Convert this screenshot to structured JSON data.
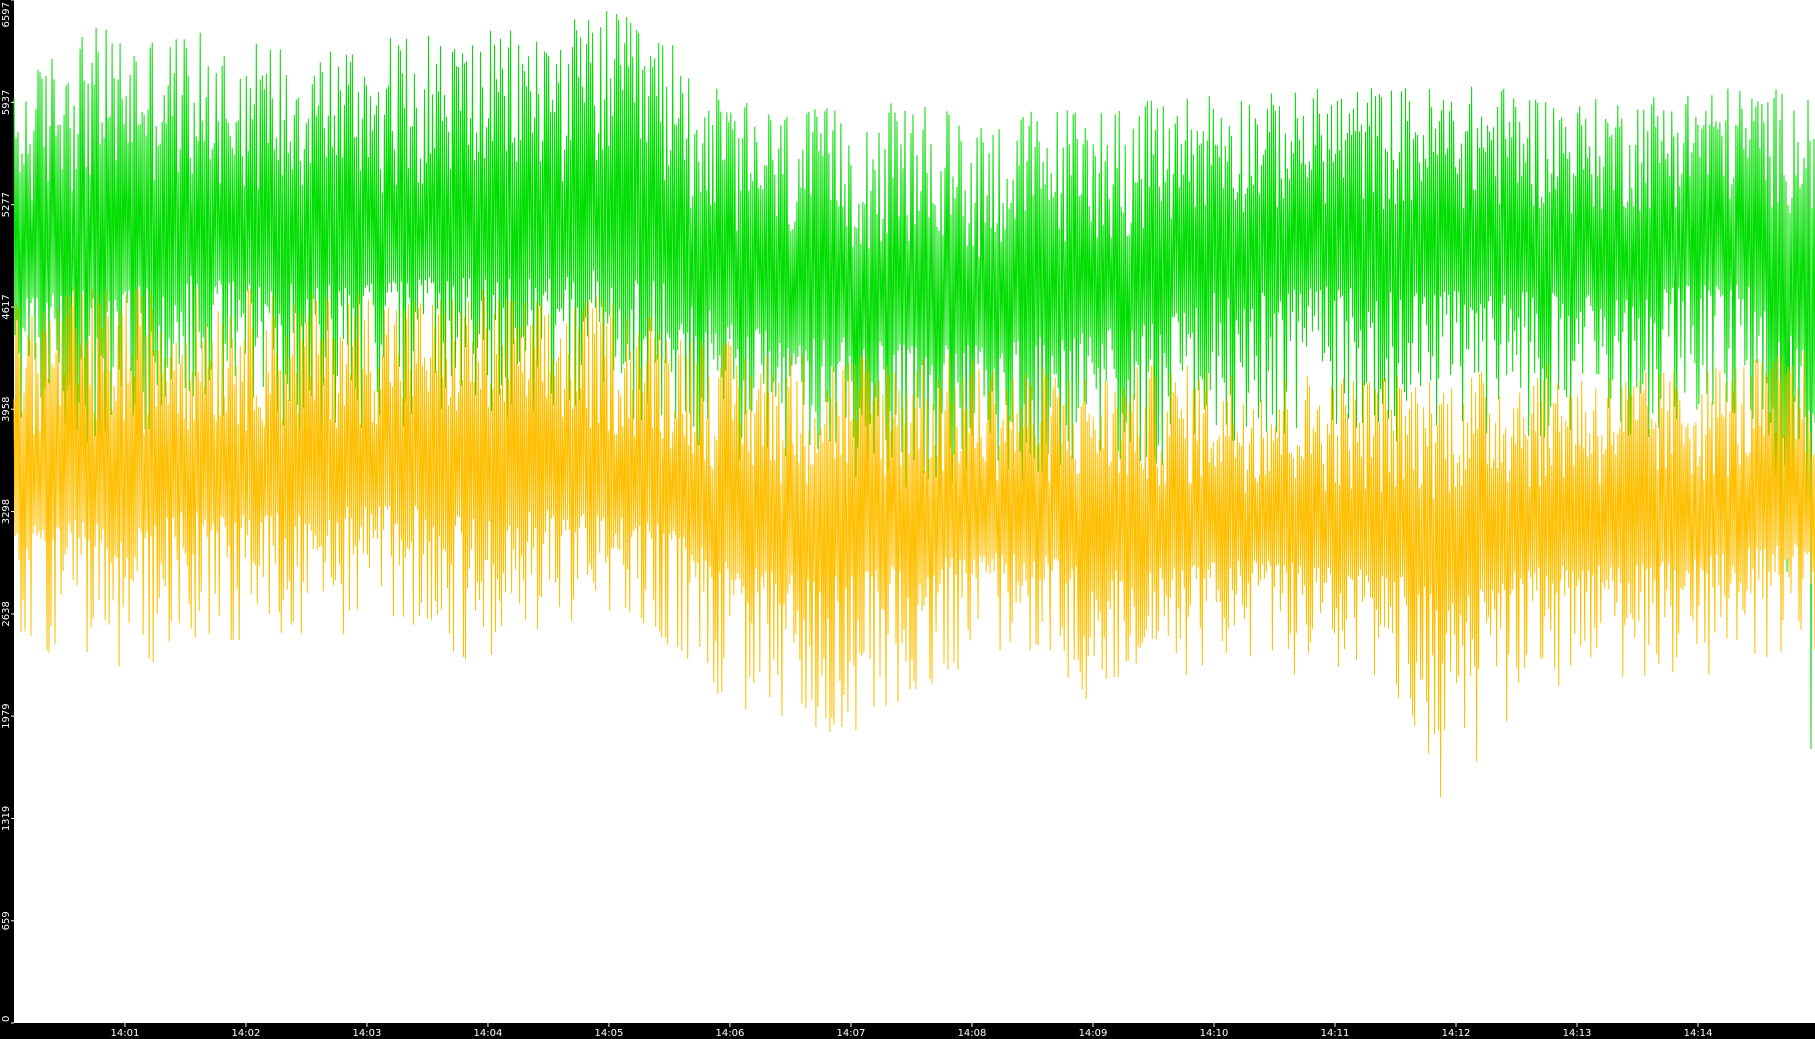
{
  "chart_data": {
    "type": "line",
    "title": "",
    "xlabel": "",
    "ylabel": "",
    "ylim": [
      0,
      6597
    ],
    "xlim": [
      "14:00:05",
      "14:14:58"
    ],
    "grid": false,
    "legend": "none",
    "background": "#ffffff",
    "frame_color": "#000000",
    "yticks": [
      0,
      659,
      1319,
      1979,
      2638,
      3298,
      3958,
      4617,
      5277,
      5937,
      6597
    ],
    "ytick_labels": [
      "0",
      "659",
      "1319",
      "1979",
      "2638",
      "3298",
      "3958",
      "4617",
      "5277",
      "5937",
      "6597"
    ],
    "xticks": [
      "14:01",
      "14:02",
      "14:03",
      "14:04",
      "14:05",
      "14:06",
      "14:07",
      "14:08",
      "14:09",
      "14:10",
      "14:11",
      "14:12",
      "14:13",
      "14:14"
    ],
    "xtick_labels": [
      "14:01",
      "14:02",
      "14:03",
      "14:04",
      "14:05",
      "14:06",
      "14:07",
      "14:08",
      "14:09",
      "14:10",
      "14:11",
      "14:12",
      "14:13",
      "14:14"
    ],
    "series": [
      {
        "color": "#00dd00",
        "x": [
          "14:00:05",
          "14:00:35",
          "14:01:00",
          "14:01:30",
          "14:02:00",
          "14:02:30",
          "14:03:00",
          "14:03:30",
          "14:04:00",
          "14:04:30",
          "14:05:00",
          "14:05:30",
          "14:06:00",
          "14:06:30",
          "14:07:00",
          "14:07:30",
          "14:08:00",
          "14:08:30",
          "14:09:00",
          "14:09:30",
          "14:10:00",
          "14:10:30",
          "14:11:00",
          "14:11:30",
          "14:12:00",
          "14:12:30",
          "14:13:00",
          "14:13:30",
          "14:14:00",
          "14:14:30",
          "14:14:58"
        ],
        "y_min": [
          3900,
          3700,
          3750,
          3900,
          3850,
          3800,
          3800,
          3850,
          3800,
          3900,
          3950,
          3800,
          3600,
          3550,
          3500,
          3450,
          3450,
          3500,
          3500,
          3550,
          3750,
          3750,
          3800,
          3750,
          3800,
          3800,
          3700,
          3750,
          3850,
          3800,
          1560
        ],
        "y_mean": [
          4900,
          5000,
          5050,
          5050,
          5000,
          5000,
          5000,
          5050,
          5050,
          5050,
          5100,
          5000,
          4750,
          4650,
          4650,
          4600,
          4600,
          4650,
          4700,
          4750,
          4950,
          4950,
          5000,
          4950,
          4950,
          4950,
          4950,
          4950,
          5000,
          5000,
          4900
        ],
        "y_max": [
          6000,
          6450,
          6400,
          6400,
          6350,
          6350,
          6350,
          6400,
          6400,
          6450,
          6550,
          6350,
          5950,
          5900,
          5900,
          5950,
          5850,
          5900,
          5950,
          5950,
          6050,
          6000,
          6050,
          6050,
          6050,
          6050,
          5950,
          6000,
          6050,
          6050,
          6000
        ]
      },
      {
        "color": "#ffbf00",
        "x": [
          "14:00:05",
          "14:00:35",
          "14:01:00",
          "14:01:30",
          "14:02:00",
          "14:02:30",
          "14:03:00",
          "14:03:30",
          "14:04:00",
          "14:04:30",
          "14:05:00",
          "14:05:30",
          "14:06:00",
          "14:06:30",
          "14:07:00",
          "14:07:30",
          "14:08:00",
          "14:08:30",
          "14:09:00",
          "14:09:30",
          "14:10:00",
          "14:10:30",
          "14:11:00",
          "14:11:30",
          "14:12:00",
          "14:12:30",
          "14:13:00",
          "14:13:30",
          "14:14:00",
          "14:14:30",
          "14:14:58"
        ],
        "y_min": [
          2300,
          2450,
          2100,
          2500,
          2400,
          2500,
          2500,
          2550,
          2150,
          2600,
          2550,
          2400,
          2000,
          1850,
          1860,
          2100,
          2300,
          2400,
          2000,
          2150,
          2300,
          2300,
          2100,
          2100,
          1200,
          2050,
          2150,
          2200,
          2200,
          2350,
          2350
        ],
        "y_mean": [
          3400,
          3450,
          3450,
          3500,
          3500,
          3500,
          3550,
          3550,
          3500,
          3500,
          3450,
          3400,
          3200,
          3150,
          3150,
          3200,
          3200,
          3200,
          3150,
          3150,
          3150,
          3150,
          3150,
          3100,
          3100,
          3150,
          3150,
          3150,
          3200,
          3250,
          3300
        ],
        "y_max": [
          4650,
          4750,
          4750,
          4750,
          4750,
          4700,
          4750,
          4700,
          4750,
          4650,
          4700,
          4550,
          4400,
          4350,
          4350,
          4350,
          4300,
          4250,
          4200,
          4250,
          4250,
          4200,
          4200,
          4200,
          4200,
          4250,
          4250,
          4200,
          4250,
          4300,
          4350
        ]
      }
    ]
  }
}
